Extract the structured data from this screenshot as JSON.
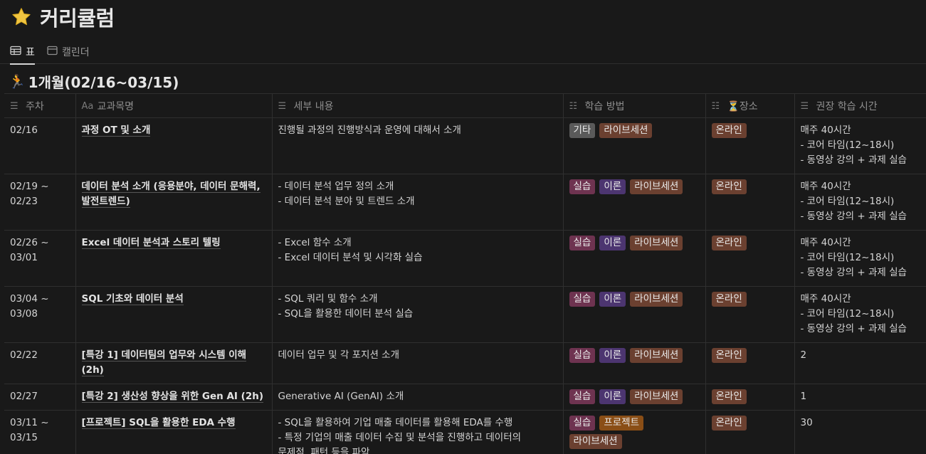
{
  "page": {
    "title": "커리큘럼",
    "icon": "star-icon"
  },
  "tabs": [
    {
      "label": "표",
      "icon": "table-icon",
      "active": true
    },
    {
      "label": "캘린더",
      "icon": "calendar-icon",
      "active": false
    }
  ],
  "group": {
    "icon": "running-person-icon",
    "title": "1개월(02/16~03/15)"
  },
  "columns": [
    {
      "label": "주차",
      "icon": "text-icon"
    },
    {
      "label": "교과목명",
      "icon": "Aa"
    },
    {
      "label": "세부 내용",
      "icon": "text-icon"
    },
    {
      "label": "학습 방법",
      "icon": "list-icon"
    },
    {
      "label": "⏳장소",
      "icon": "list-icon"
    },
    {
      "label": "권장 학습 시간",
      "icon": "text-icon"
    }
  ],
  "tag_colors": {
    "기타": "#5a5a5a",
    "라이브세션": "#6b4030",
    "실습": "#6e3350",
    "이론": "#4c3570",
    "프로젝트": "#8a4e16",
    "온라인": "#6b4030"
  },
  "rows": [
    {
      "week": [
        "02/16"
      ],
      "subject": "과정 OT 및 소개",
      "details": [
        "진행될 과정의 진행방식과 운영에 대해서 소개"
      ],
      "methods": [
        "기타",
        "라이브세션"
      ],
      "place": [
        "온라인"
      ],
      "hours": [
        "매주 40시간",
        "- 코어 타임(12~18시)",
        "- 동영상 강의 + 과제 실습"
      ]
    },
    {
      "week": [
        "02/19 ~",
        "02/23"
      ],
      "subject": "데이터 분석 소개 (응용분야, 데이터 문해력, 발전트렌드)",
      "details": [
        "- 데이터 분석 업무 정의 소개",
        "- 데이터 분석 분야 및 트렌드 소개"
      ],
      "methods": [
        "실습",
        "이론",
        "라이브세션"
      ],
      "place": [
        "온라인"
      ],
      "hours": [
        "매주 40시간",
        "- 코어 타임(12~18시)",
        "- 동영상 강의 + 과제 실습"
      ]
    },
    {
      "week": [
        "02/26 ~",
        "03/01"
      ],
      "subject": "Excel 데이터 분석과 스토리 텔링",
      "details": [
        "- Excel 함수 소개",
        "- Excel 데이터 분석 및 시각화 실습"
      ],
      "methods": [
        "실습",
        "이론",
        "라이브세션"
      ],
      "place": [
        "온라인"
      ],
      "hours": [
        "매주 40시간",
        "- 코어 타임(12~18시)",
        "- 동영상 강의 + 과제 실습"
      ]
    },
    {
      "week": [
        "03/04 ~",
        "03/08"
      ],
      "subject": "SQL 기초와 데이터 분석",
      "details": [
        "- SQL 쿼리 및 함수 소개",
        "- SQL을 활용한 데이터 분석 실습"
      ],
      "methods": [
        "실습",
        "이론",
        "라이브세션"
      ],
      "place": [
        "온라인"
      ],
      "hours": [
        "매주 40시간",
        "- 코어 타임(12~18시)",
        "- 동영상 강의 + 과제 실습"
      ]
    },
    {
      "week": [
        "02/22"
      ],
      "subject": "[특강 1] 데이터팀의 업무와 시스템 이해 (2h)",
      "details": [
        "데이터 업무 및 각 포지션 소개"
      ],
      "methods": [
        "실습",
        "이론",
        "라이브세션"
      ],
      "place": [
        "온라인"
      ],
      "hours": [
        "2"
      ]
    },
    {
      "week": [
        "02/27"
      ],
      "subject": "[특강 2] 생산성 향상을 위한 Gen AI (2h)",
      "details": [
        "Generative AI (GenAI) 소개"
      ],
      "methods": [
        "실습",
        "이론",
        "라이브세션"
      ],
      "place": [
        "온라인"
      ],
      "hours": [
        "1"
      ]
    },
    {
      "week": [
        "03/11 ~",
        "03/15"
      ],
      "subject": "[프로젝트] SQL을 활용한 EDA 수행",
      "details": [
        "- SQL을 활용하여 기업 매출 데이터를 활용해 EDA를 수행",
        "- 특정 기업의 매출 데이터 수집 및 분석을 진행하고 데이터의",
        "문제점, 패턴 등을 파악"
      ],
      "methods": [
        "실습",
        "프로젝트",
        "라이브세션"
      ],
      "place": [
        "온라인"
      ],
      "hours": [
        "30"
      ]
    }
  ]
}
